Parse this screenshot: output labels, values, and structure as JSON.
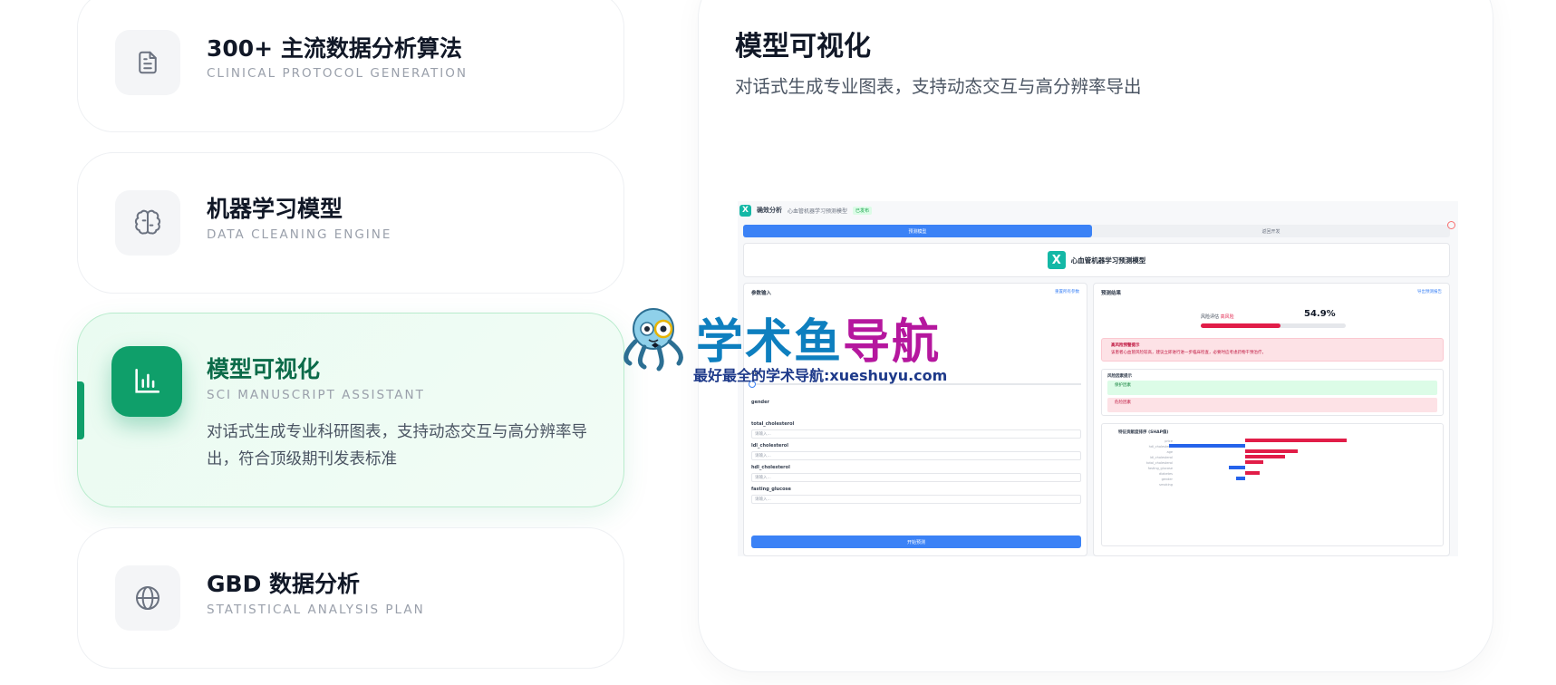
{
  "features": [
    {
      "title": "300+ 主流数据分析算法",
      "subtitle": "CLINICAL PROTOCOL GENERATION",
      "icon": "document-icon"
    },
    {
      "title": "机器学习模型",
      "subtitle": "DATA CLEANING ENGINE",
      "icon": "brain-icon"
    },
    {
      "title": "模型可视化",
      "subtitle": "SCI MANUSCRIPT ASSISTANT",
      "icon": "bar-chart-icon",
      "active": true,
      "description": "对话式生成专业科研图表，支持动态交互与高分辨率导出，符合顶级期刊发表标准"
    },
    {
      "title": "GBD 数据分析",
      "subtitle": "STATISTICAL ANALYSIS PLAN",
      "icon": "globe-icon"
    }
  ],
  "preview": {
    "title": "模型可视化",
    "subtitle": "对话式生成专业图表，支持动态交互与高分辨率导出"
  },
  "app": {
    "brand": "确效分析",
    "crumb": "心血管机器学习预测模型",
    "tag": "已发布",
    "tab_active": "预测模型",
    "tab_other": "返回开发",
    "hero_title": "心血管机器学习预测模型",
    "input_panel_title": "参数输入",
    "input_panel_action": "重置所有参数",
    "fields": [
      "gender",
      "age",
      "total_cholesterol",
      "ldl_cholesterol",
      "hdl_cholesterol",
      "fasting_glucose"
    ],
    "input_placeholder": "请输入...",
    "predict_button": "开始预测",
    "result_panel_title": "预测结果",
    "result_panel_action": "导出预测报告",
    "probability_label": "风险评估",
    "probability_level": "高风险",
    "probability": "54.9%",
    "probability_value": 0.549,
    "alert_title": "高风险预警提示",
    "alert_text": "该患者心血管风险较高，建议立即进行进一步临床检查，必要时应考虑药物干预治疗。",
    "factors_title": "风险因素提示",
    "protective_label": "保护因素",
    "risk_label": "危险因素",
    "shap_title": "特征贡献度排序 (SHAP值)",
    "shap_features": [
      "price",
      "hdl_cholesterol",
      "age",
      "ldl_cholesterol",
      "total_cholesterol",
      "fasting_glucose",
      "diabetes",
      "gender",
      "smoking"
    ],
    "shap_values": [
      0.56,
      -0.42,
      0.29,
      0.22,
      0.1,
      -0.09,
      0.08,
      -0.05,
      0.0
    ],
    "colors": {
      "positive": "#e11d48",
      "negative": "#2563eb",
      "accent": "#3b82f6"
    }
  },
  "watermark": {
    "part1": "学术鱼",
    "part2": "导航",
    "subtitle": "最好最全的学术导航:xueshuyu.com"
  }
}
